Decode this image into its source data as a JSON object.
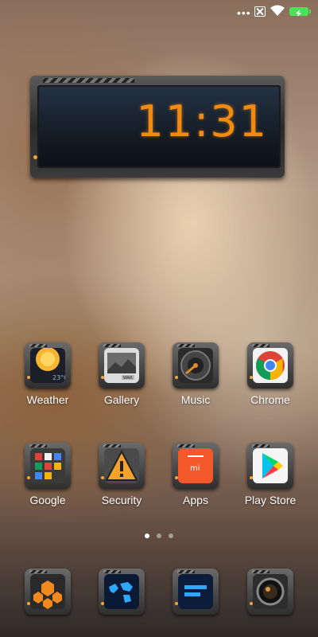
{
  "status_bar": {
    "overflow": "•••",
    "icons": [
      "no-sim-icon",
      "wifi-icon",
      "battery-charging-icon"
    ],
    "battery_color": "#4be158"
  },
  "clock_widget": {
    "time": "11:31",
    "color": "#f28a12"
  },
  "apps_row1": [
    {
      "label": "Weather",
      "icon": "weather-icon"
    },
    {
      "label": "Gallery",
      "icon": "gallery-icon"
    },
    {
      "label": "Music",
      "icon": "music-icon"
    },
    {
      "label": "Chrome",
      "icon": "chrome-icon"
    }
  ],
  "apps_row2": [
    {
      "label": "Google",
      "icon": "google-folder-icon"
    },
    {
      "label": "Security",
      "icon": "security-icon"
    },
    {
      "label": "Apps",
      "icon": "mi-apps-icon"
    },
    {
      "label": "Play Store",
      "icon": "play-store-icon"
    }
  ],
  "page_indicator": {
    "count": 3,
    "active": 0
  },
  "dock": [
    {
      "icon": "phone-icon"
    },
    {
      "icon": "browser-map-icon"
    },
    {
      "icon": "messages-icon"
    },
    {
      "icon": "camera-icon"
    }
  ]
}
